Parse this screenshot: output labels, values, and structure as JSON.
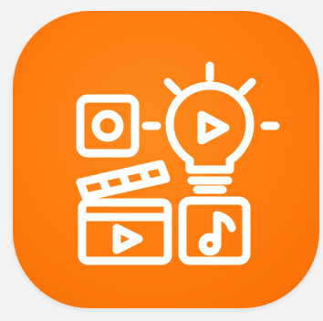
{
  "icon": {
    "name": "creative-media-app-icon",
    "background_color": "#ff7a0e",
    "foreground_color": "#ffffff",
    "components": [
      "camera-icon",
      "lightbulb-play-icon",
      "clapperboard-icon",
      "music-note-icon"
    ]
  }
}
